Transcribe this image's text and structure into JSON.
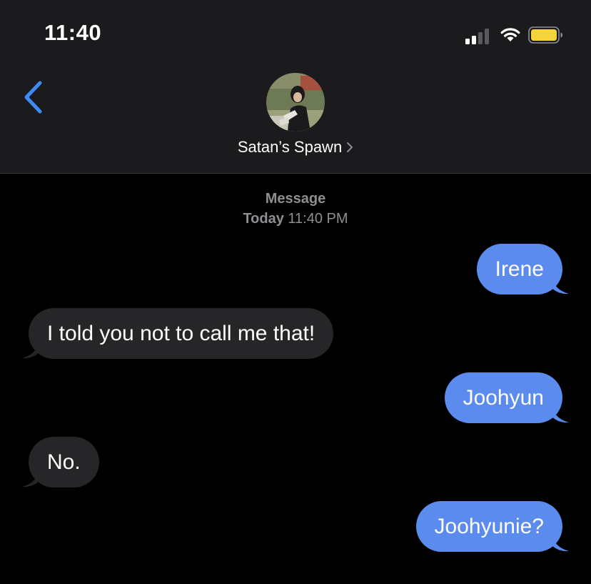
{
  "status_bar": {
    "time": "11:40"
  },
  "header": {
    "contact_name": "Satan’s Spawn"
  },
  "conversation": {
    "service_label": "Message",
    "timestamp_day": "Today",
    "timestamp_time": "11:40 PM"
  },
  "messages": [
    {
      "direction": "sent",
      "text": "Irene"
    },
    {
      "direction": "received",
      "text": "I told you not to call me that!"
    },
    {
      "direction": "sent",
      "text": "Joohyun"
    },
    {
      "direction": "received",
      "text": "No."
    },
    {
      "direction": "sent",
      "text": "Joohyunie?"
    }
  ],
  "colors": {
    "sent_bubble": "#5b8ced",
    "received_bubble": "#262628",
    "accent": "#3d8bf7",
    "battery": "#f5d33b"
  },
  "icons": {
    "back": "chevron-left-icon",
    "signal": "cellular-signal-icon",
    "wifi": "wifi-icon",
    "battery": "battery-icon",
    "contact_details": "chevron-right-icon"
  }
}
